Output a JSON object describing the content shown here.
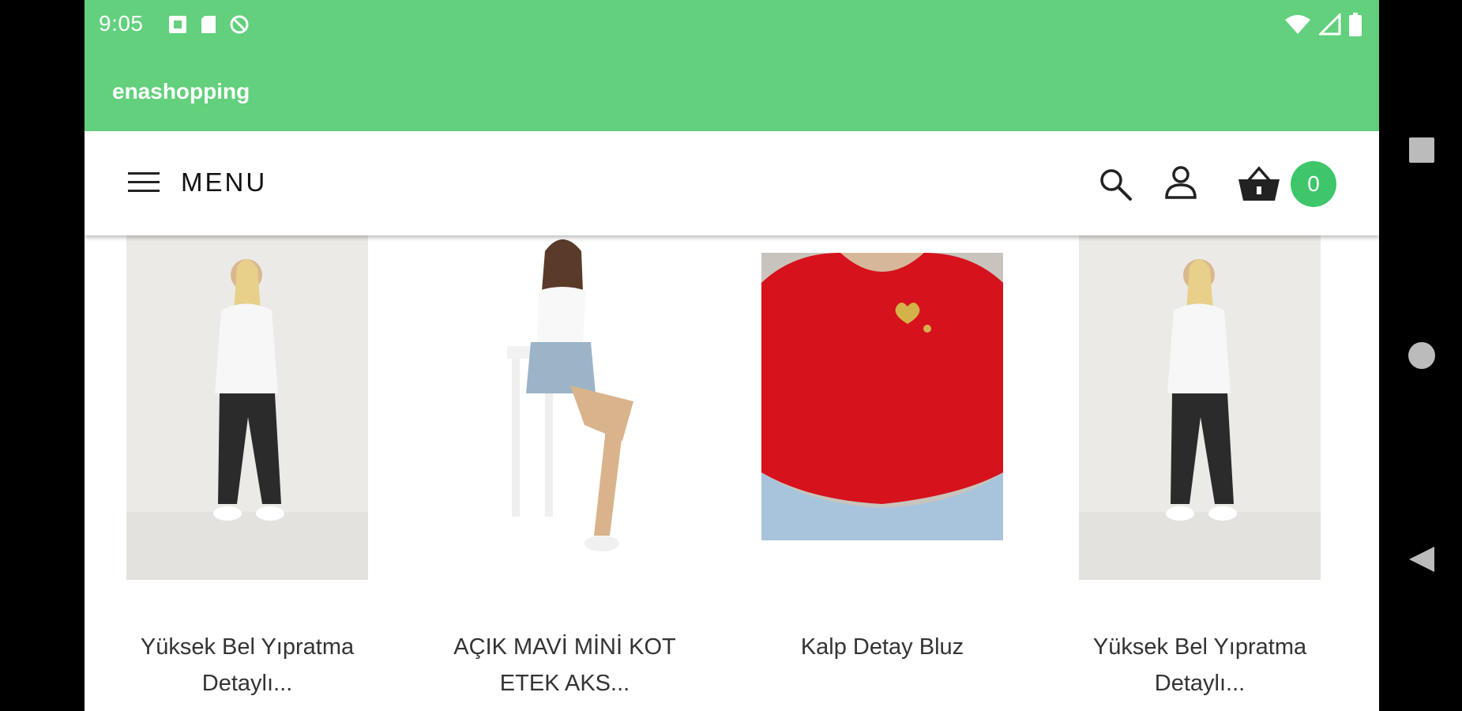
{
  "status_bar": {
    "time": "9:05",
    "left_icons": [
      "notification-icon",
      "sd-card-icon",
      "no-data-icon"
    ],
    "right_icons": [
      "wifi-icon",
      "signal-icon",
      "battery-icon"
    ]
  },
  "app_bar": {
    "title": "enashopping",
    "color": "#62d07c"
  },
  "header": {
    "menu_label": "MENU",
    "icons": [
      "hamburger-icon",
      "search-icon",
      "account-icon",
      "cart-icon"
    ],
    "cart_count": "0",
    "badge_color": "#3fc66a"
  },
  "products": [
    {
      "name": "Yüksek Bel Yıpratma Detaylı...",
      "image": "woman in white crop top and black jeans"
    },
    {
      "name": "AÇIK MAVİ MİNİ KOT ETEK AKS...",
      "image": "woman in denim shorts on bar stool"
    },
    {
      "name": "Kalp Detay Bluz",
      "image": "red blouse with gold heart"
    },
    {
      "name": "Yüksek Bel Yıpratma Detaylı...",
      "image": "woman in white crop top and black jeans"
    }
  ],
  "nav_bar": {
    "icons": [
      "recents-icon",
      "home-icon",
      "back-icon"
    ]
  }
}
